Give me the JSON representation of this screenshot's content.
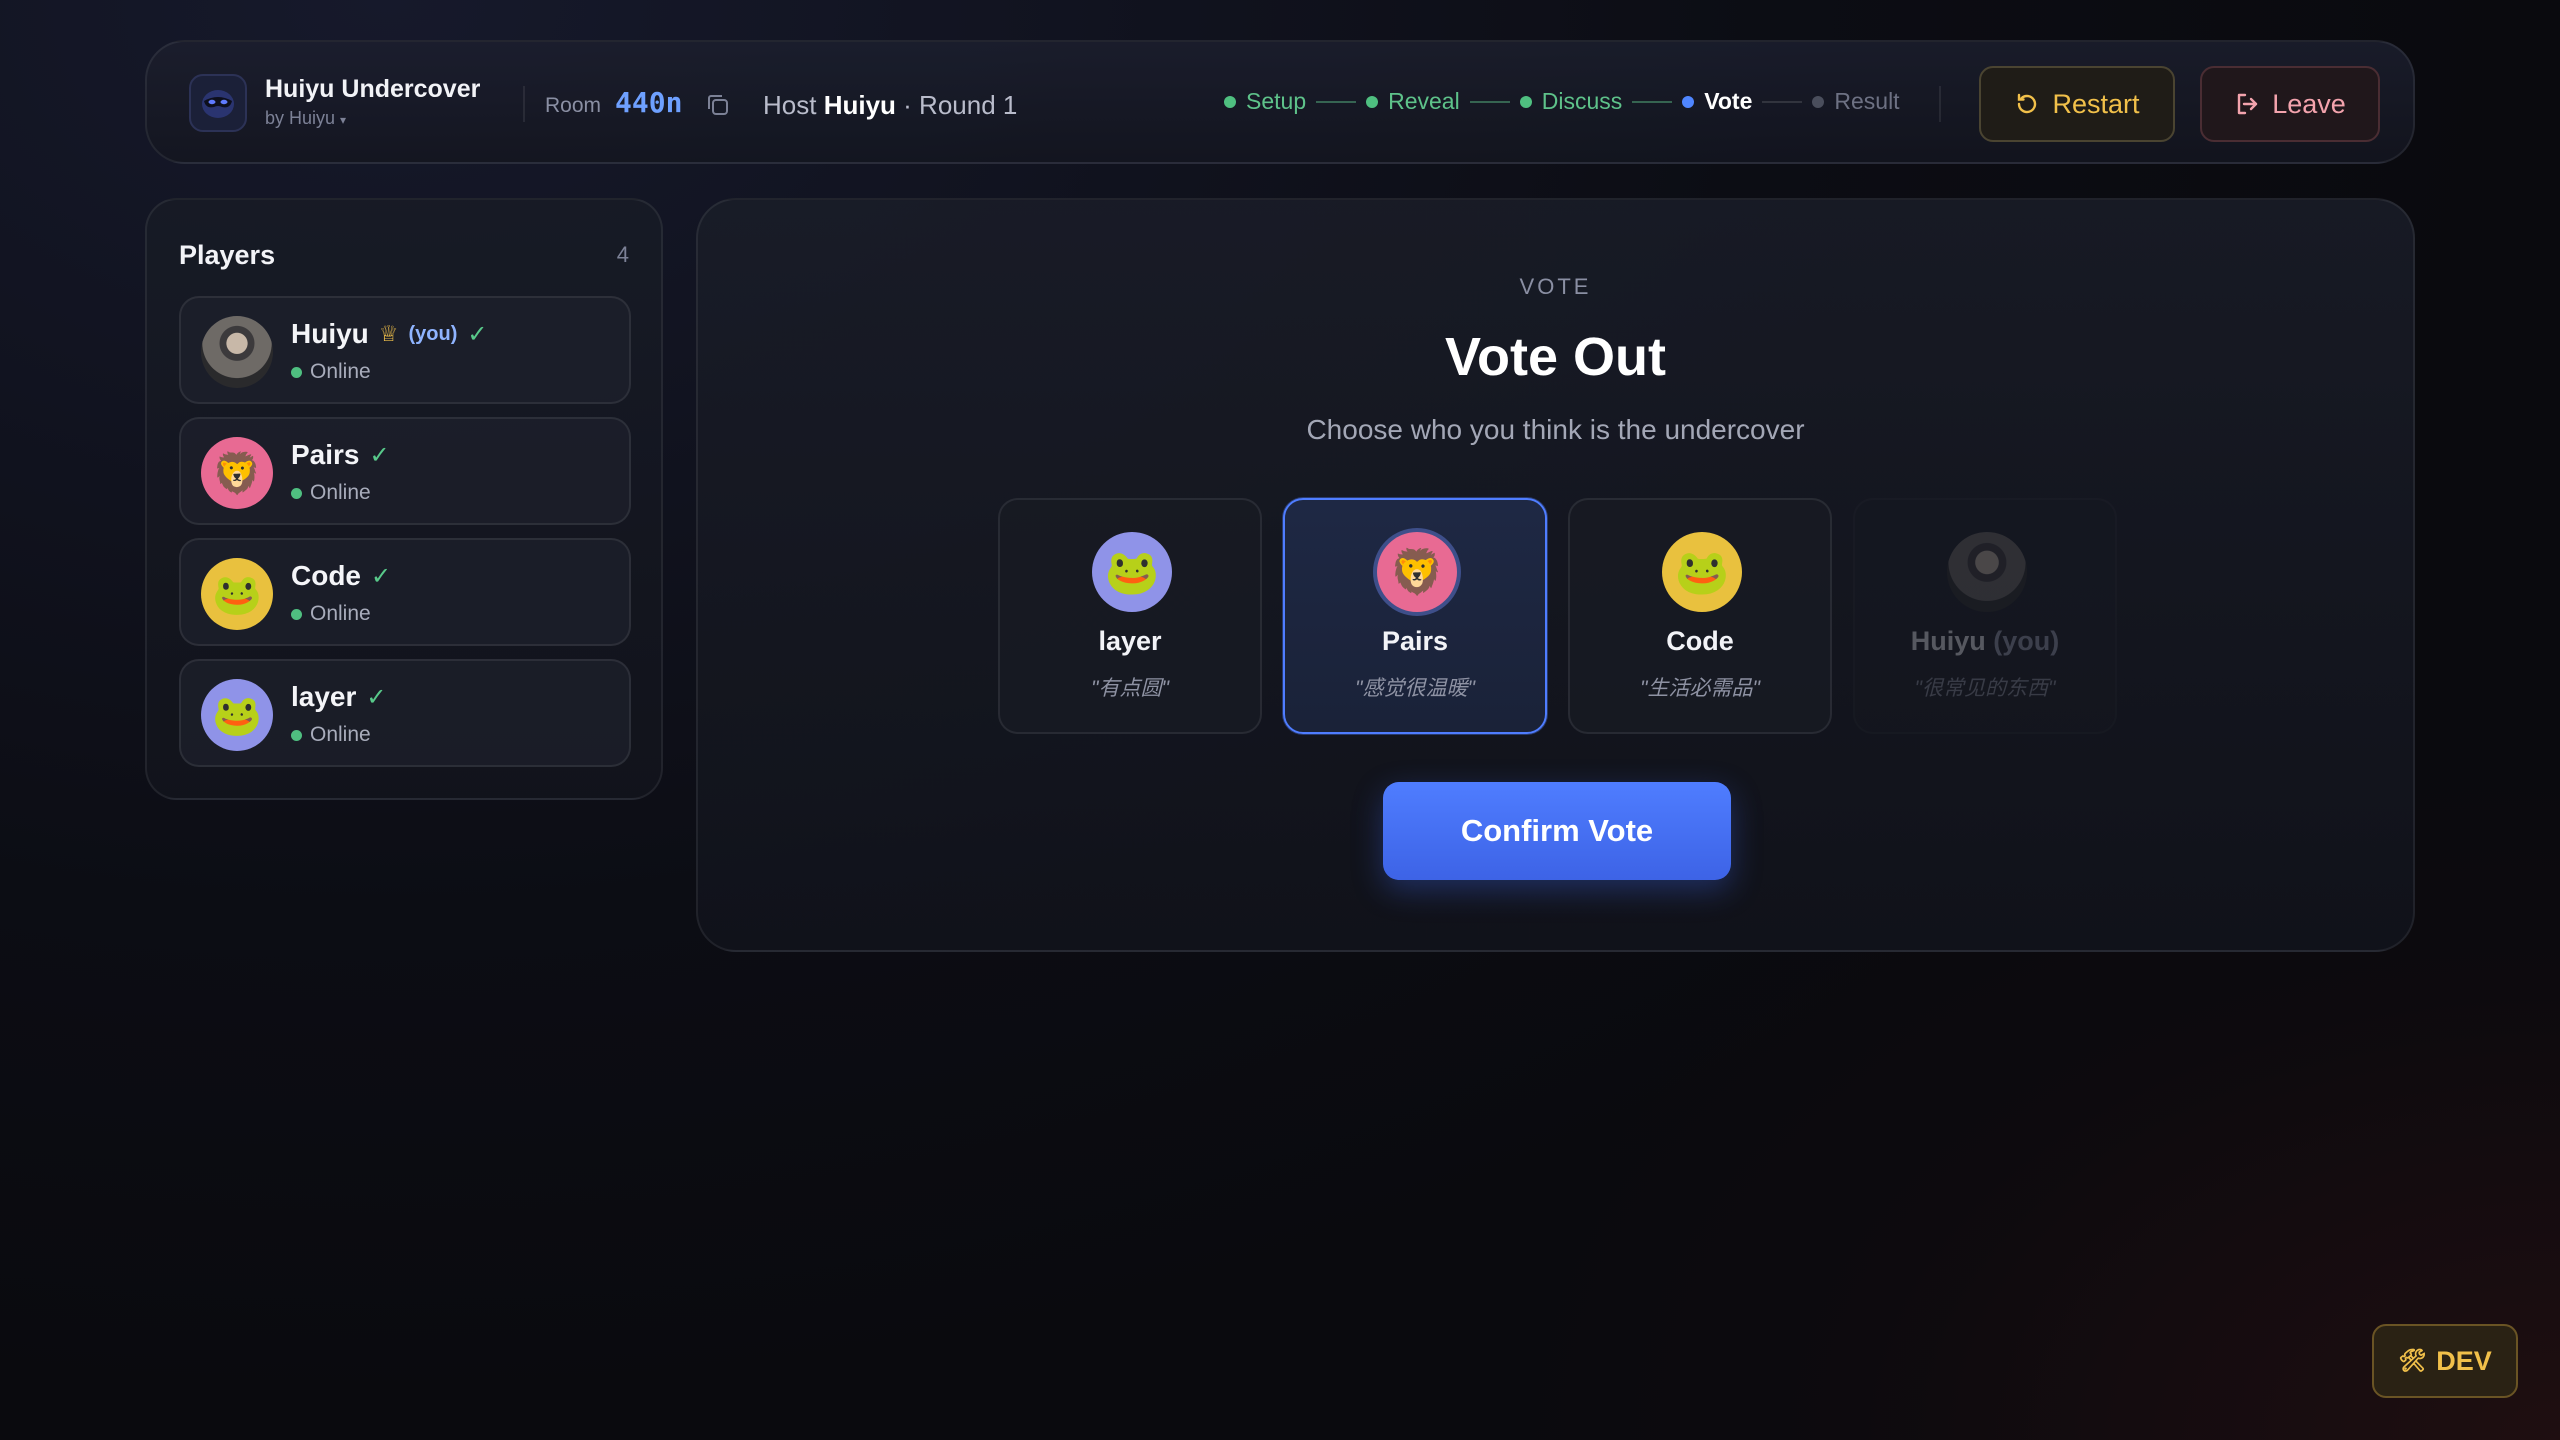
{
  "app": {
    "title": "Huiyu Undercover",
    "subtitle": "by Huiyu",
    "subtitle_chevron": "▾"
  },
  "room": {
    "label": "Room",
    "code": "440n"
  },
  "host_line": {
    "host_label": "Host",
    "host_name": "Huiyu",
    "round": "· Round 1"
  },
  "steps": [
    {
      "label": "Setup",
      "state": "done"
    },
    {
      "label": "Reveal",
      "state": "done"
    },
    {
      "label": "Discuss",
      "state": "done"
    },
    {
      "label": "Vote",
      "state": "active"
    },
    {
      "label": "Result",
      "state": "pending"
    }
  ],
  "actions": {
    "restart_label": "Restart",
    "leave_label": "Leave"
  },
  "players_panel": {
    "title": "Players",
    "count": "4",
    "players": [
      {
        "name": "Huiyu",
        "crown": "♕",
        "you": "(you)",
        "check": "✓",
        "status": "Online",
        "avatar": "photo"
      },
      {
        "name": "Pairs",
        "check": "✓",
        "status": "Online",
        "avatar": "🦁"
      },
      {
        "name": "Code",
        "check": "✓",
        "status": "Online",
        "avatar": "🐸"
      },
      {
        "name": "layer",
        "check": "✓",
        "status": "Online",
        "avatar": "🐸"
      }
    ]
  },
  "vote": {
    "kicker": "VOTE",
    "title": "Vote Out",
    "subtitle": "Choose who you think is the undercover",
    "candidates": [
      {
        "name": "layer",
        "word": "\"有点圆\"",
        "avatar": "🐸",
        "selected": false
      },
      {
        "name": "Pairs",
        "word": "\"感觉很温暖\"",
        "avatar": "🦁",
        "selected": true
      },
      {
        "name": "Code",
        "word": "\"生活必需品\"",
        "avatar": "🐸",
        "selected": false
      },
      {
        "name": "Huiyu",
        "you": "(you)",
        "word": "\"很常见的东西\"",
        "avatar": "photo",
        "selected": false
      }
    ],
    "confirm_label": "Confirm Vote"
  },
  "dev": {
    "label": "DEV",
    "icon": "🛠"
  },
  "colors": {
    "accent": "#4f7dff",
    "online": "#4fbf80",
    "restart": "#f1c04a",
    "leave": "#f3a3ad"
  }
}
